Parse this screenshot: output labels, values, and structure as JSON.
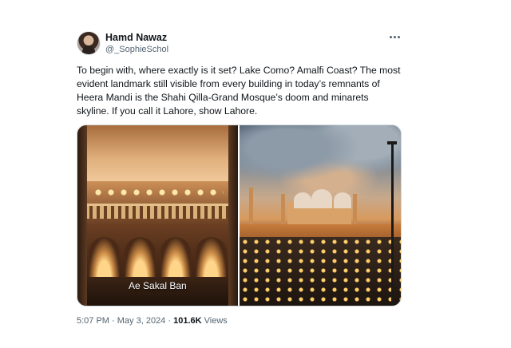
{
  "tweet": {
    "author_name": "Hamd Nawaz",
    "author_handle": "@_SophieSchol",
    "text": "To begin with, where exactly is it set? Lake Como? Amalfi Coast? The most evident landmark still visible from every building in today’s remnants of Heera Mandi is the Shahi Qilla-Grand Mosque’s doom and minarets skyline. If you call it Lahore, show Lahore.",
    "media": [
      {
        "caption": "Ae Sakal Ban"
      },
      {
        "caption": ""
      }
    ],
    "time": "5:07 PM",
    "separator": "·",
    "date": "May 3, 2024",
    "views_count": "101.6K",
    "views_label": "Views"
  },
  "icons": {
    "more": "more-horizontal-icon"
  },
  "colors": {
    "text_primary": "#0f1419",
    "text_secondary": "#536471",
    "border": "#cfd9de"
  }
}
